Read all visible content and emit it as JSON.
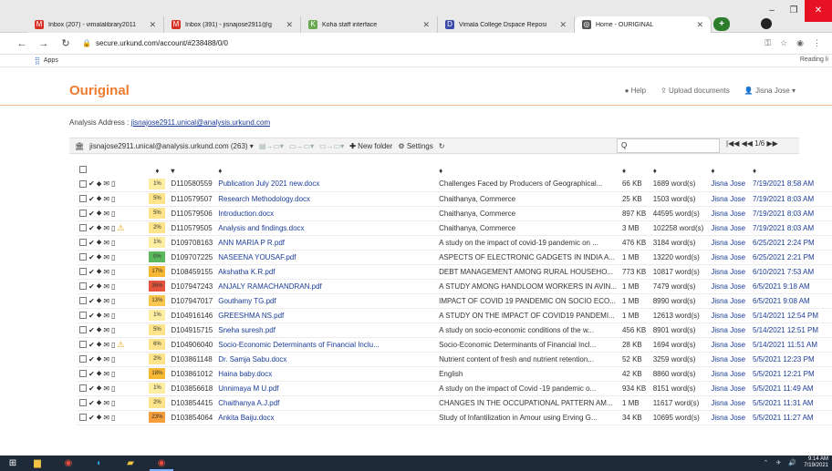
{
  "browser": {
    "tabs": [
      {
        "label": "Inbox (207) - vimalalibrary2011",
        "icon": "gmail-icon",
        "color": "#d93025",
        "glyph": "M"
      },
      {
        "label": "Inbox (391) - jisnajose2911@g",
        "icon": "gmail-icon",
        "color": "#d93025",
        "glyph": "M"
      },
      {
        "label": "Koha staff interface",
        "icon": "koha-icon",
        "color": "#6aa84f",
        "glyph": "K"
      },
      {
        "label": "Vimala College Dspace Reposi",
        "icon": "dspace-icon",
        "color": "#3c4aa8",
        "glyph": "D"
      },
      {
        "label": "Home - OURIGINAL",
        "icon": "ouriginal-icon",
        "color": "#555555",
        "glyph": "◎"
      }
    ],
    "new_tab": "+",
    "url": "secure.urkund.com/account/#238488/0/0",
    "bookmarks_apps": "Apps",
    "reading_list": "Reading li"
  },
  "app": {
    "brand": "Ouriginal",
    "brand_color": "#ef7b2f",
    "help": "Help",
    "upload": "Upload documents",
    "user": "Jisna Jose"
  },
  "analysis": {
    "label": "Analysis Address :",
    "email": "jisnajose2911.unical@analysis.urkund.com"
  },
  "toolbar": {
    "mailbox": "jisnajose2911.unical@analysis.urkund.com (263)",
    "new_folder": "New folder",
    "settings": "Settings",
    "search_value": "Q",
    "pager": "|◀◀ ◀◀ 1/6 ▶▶"
  },
  "table": {
    "headers": [
      "",
      "♦",
      "▾",
      "♦",
      "♦",
      "♦",
      "♦",
      "♦",
      "♦"
    ],
    "rows": [
      {
        "sig": "1%",
        "sigcolor": "#fdeda0",
        "id": "D110580559",
        "doc": "Publication July 2021 new.docx",
        "subject": "Challenges Faced by Producers of Geographical...",
        "size": "66 KB",
        "words": "1689 word(s)",
        "by": "Jisna Jose",
        "date": "7/19/2021 8:58 AM",
        "warn": false
      },
      {
        "sig": "5%",
        "sigcolor": "#fde38a",
        "id": "D110579507",
        "doc": "Research Methodology.docx",
        "subject": "Chaithanya, Commerce",
        "size": "25 KB",
        "words": "1503 word(s)",
        "by": "Jisna Jose",
        "date": "7/19/2021 8:03 AM",
        "warn": false
      },
      {
        "sig": "5%",
        "sigcolor": "#fde38a",
        "id": "D110579506",
        "doc": "Introduction.docx",
        "subject": "Chaithanya, Commerce",
        "size": "897 KB",
        "words": "44595 word(s)",
        "by": "Jisna Jose",
        "date": "7/19/2021 8:03 AM",
        "warn": false
      },
      {
        "sig": "2%",
        "sigcolor": "#fde38a",
        "id": "D110579505",
        "doc": "Analysis and findings.docx",
        "subject": "Chaithanya, Commerce",
        "size": "3 MB",
        "words": "102258 word(s)",
        "by": "Jisna Jose",
        "date": "7/19/2021 8:03 AM",
        "warn": true
      },
      {
        "sig": "1%",
        "sigcolor": "#fdeda0",
        "id": "D109708163",
        "doc": "ANN MARIA P R.pdf",
        "subject": "A study on the impact of covid-19 pandemic on ...",
        "size": "476 KB",
        "words": "3184 word(s)",
        "by": "Jisna Jose",
        "date": "6/25/2021 2:24 PM",
        "warn": false
      },
      {
        "sig": "0%",
        "sigcolor": "#5cb85c",
        "id": "D109707225",
        "doc": "NASEENA YOUSAF.pdf",
        "subject": "ASPECTS OF ELECTRONIC GADGETS IN INDIA A...",
        "size": "1 MB",
        "words": "13220 word(s)",
        "by": "Jisna Jose",
        "date": "6/25/2021 2:21 PM",
        "warn": false
      },
      {
        "sig": "17%",
        "sigcolor": "#f7b733",
        "id": "D108459155",
        "doc": "Akshatha K.R.pdf",
        "subject": "DEBT MANAGEMENT AMONG RURAL HOUSEHO...",
        "size": "773 KB",
        "words": "10817 word(s)",
        "by": "Jisna Jose",
        "date": "6/10/2021 7:53 AM",
        "warn": false
      },
      {
        "sig": "36%",
        "sigcolor": "#e5533d",
        "id": "D107947243",
        "doc": "ANJALY RAMACHANDRAN.pdf",
        "subject": "A STUDY AMONG HANDLOOM WORKERS IN AVIN...",
        "size": "1 MB",
        "words": "7479 word(s)",
        "by": "Jisna Jose",
        "date": "6/5/2021 9:18 AM",
        "warn": false
      },
      {
        "sig": "13%",
        "sigcolor": "#f9c74f",
        "id": "D107947017",
        "doc": "Gouthamy TG.pdf",
        "subject": "IMPACT OF COVID 19 PANDEMIC ON SOCIO ECO...",
        "size": "1 MB",
        "words": "8990 word(s)",
        "by": "Jisna Jose",
        "date": "6/5/2021 9:08 AM",
        "warn": false
      },
      {
        "sig": "1%",
        "sigcolor": "#fdeda0",
        "id": "D104916146",
        "doc": "GREESHMA NS.pdf",
        "subject": "A STUDY ON THE IMPACT OF COVID19 PANDEMI...",
        "size": "1 MB",
        "words": "12613 word(s)",
        "by": "Jisna Jose",
        "date": "5/14/2021 12:54 PM",
        "warn": false
      },
      {
        "sig": "5%",
        "sigcolor": "#fde38a",
        "id": "D104915715",
        "doc": "Sneha suresh.pdf",
        "subject": "A study on socio-economic conditions of the w...",
        "size": "456 KB",
        "words": "8901 word(s)",
        "by": "Jisna Jose",
        "date": "5/14/2021 12:51 PM",
        "warn": false
      },
      {
        "sig": "6%",
        "sigcolor": "#fde38a",
        "id": "D104906040",
        "doc": "Socio-Economic Determinants of Financial Inclu...",
        "subject": "Socio-Economic Determinants of Financial Incl...",
        "size": "28 KB",
        "words": "1694 word(s)",
        "by": "Jisna Jose",
        "date": "5/14/2021 11:51 AM",
        "warn": true
      },
      {
        "sig": "2%",
        "sigcolor": "#fde38a",
        "id": "D103861148",
        "doc": "Dr. Samja Sabu.docx",
        "subject": "Nutrient content of fresh and nutrient retention...",
        "size": "52 KB",
        "words": "3259 word(s)",
        "by": "Jisna Jose",
        "date": "5/5/2021 12:23 PM",
        "warn": false
      },
      {
        "sig": "18%",
        "sigcolor": "#f7b733",
        "id": "D103861012",
        "doc": "Haina baby.docx",
        "subject": "English",
        "size": "42 KB",
        "words": "8860 word(s)",
        "by": "Jisna Jose",
        "date": "5/5/2021 12:21 PM",
        "warn": false
      },
      {
        "sig": "1%",
        "sigcolor": "#fdeda0",
        "id": "D103856618",
        "doc": "Unnimaya M U.pdf",
        "subject": "A study on the impact of Covid -19 pandemic o...",
        "size": "934 KB",
        "words": "8151 word(s)",
        "by": "Jisna Jose",
        "date": "5/5/2021 11:49 AM",
        "warn": false
      },
      {
        "sig": "2%",
        "sigcolor": "#fde38a",
        "id": "D103854415",
        "doc": "Chaithanya A.J.pdf",
        "subject": "CHANGES IN THE OCCUPATIONAL PATTERN AM...",
        "size": "1 MB",
        "words": "11617 word(s)",
        "by": "Jisna Jose",
        "date": "5/5/2021 11:31 AM",
        "warn": false
      },
      {
        "sig": "23%",
        "sigcolor": "#f59e3b",
        "id": "D103854064",
        "doc": "Ankita Baiju.docx",
        "subject": "Study of Infantilization in Amour using Erving G...",
        "size": "34 KB",
        "words": "10695 word(s)",
        "by": "Jisna Jose",
        "date": "5/5/2021 11:27 AM",
        "warn": false
      }
    ]
  },
  "taskbar": {
    "time": "9:14 AM",
    "date": "7/19/2021"
  }
}
